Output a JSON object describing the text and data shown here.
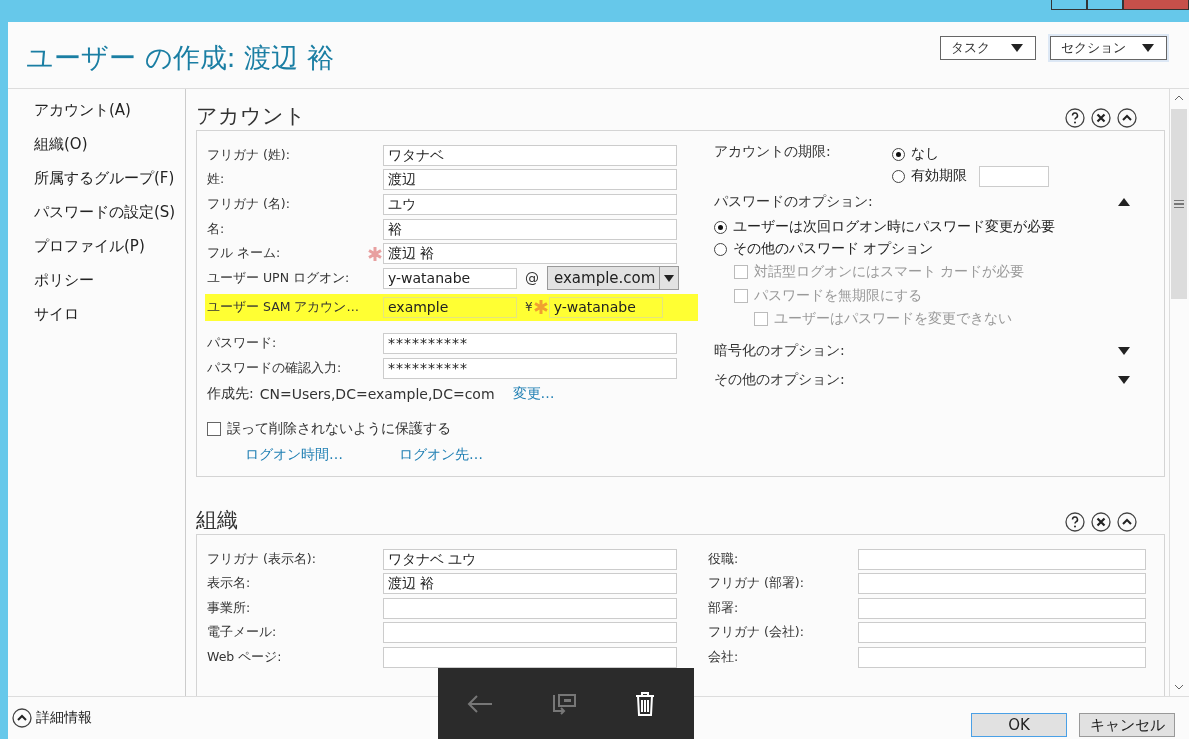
{
  "title": "ユーザー の作成: 渡辺 裕",
  "header_buttons": [
    {
      "label": "タスク"
    },
    {
      "label": "セクション"
    }
  ],
  "nav": [
    {
      "label": "アカウント(A)"
    },
    {
      "label": "組織(O)"
    },
    {
      "label": "所属するグループ(F)"
    },
    {
      "label": "パスワードの設定(S)"
    },
    {
      "label": "プロファイル(P)"
    },
    {
      "label": "ポリシー"
    },
    {
      "label": "サイロ"
    }
  ],
  "account": {
    "title": "アカウント",
    "fields": [
      {
        "label": "フリガナ (姓):",
        "kind": "text",
        "value": "ワタナベ",
        "required": false,
        "highlighted": false
      },
      {
        "label": "姓:",
        "kind": "text",
        "value": "渡辺",
        "required": false,
        "highlighted": false
      },
      {
        "label": "フリガナ (名):",
        "kind": "text",
        "value": "ユウ",
        "required": false,
        "highlighted": false
      },
      {
        "label": "名:",
        "kind": "text",
        "value": "裕",
        "required": false,
        "highlighted": false
      },
      {
        "label": "フル ネーム:",
        "kind": "text",
        "value": "渡辺 裕",
        "required": true,
        "highlighted": false
      },
      {
        "label": "ユーザー UPN ログオン:",
        "kind": "upn",
        "value": "y-watanabe",
        "separator": "@",
        "domain": "example.com",
        "required": false,
        "highlighted": false
      },
      {
        "label": "ユーザー SAM アカウン…",
        "kind": "sam",
        "prefix": "example",
        "separator": "¥",
        "value": "y-watanabe",
        "required": true,
        "highlighted": true
      }
    ],
    "password_fields": [
      {
        "label": "パスワード:",
        "value": "**********"
      },
      {
        "label": "パスワードの確認入力:",
        "value": "**********"
      }
    ],
    "created_in": {
      "label": "作成先:",
      "value": "CN=Users,DC=example,DC=com",
      "link": "変更…"
    },
    "protect": {
      "label": "誤って削除されないように保護する",
      "checked": false
    },
    "links": [
      "ログオン時間…",
      "ログオン先…"
    ],
    "expiry": {
      "label": "アカウントの期限:",
      "options": [
        {
          "label": "なし",
          "selected": true,
          "kind": "plain"
        },
        {
          "label": "有効期限",
          "selected": false,
          "kind": "date"
        }
      ]
    },
    "option_groups": [
      {
        "label": "パスワードのオプション:",
        "expanded": true,
        "radios": [
          {
            "label": "ユーザーは次回ログオン時にパスワード変更が必要",
            "selected": true
          },
          {
            "label": "その他のパスワード オプション",
            "selected": false
          }
        ],
        "checkboxes": [
          {
            "label": "対話型ログオンにはスマート カードが必要",
            "checked": false,
            "disabled": true
          },
          {
            "label": "パスワードを無期限にする",
            "checked": false,
            "disabled": true,
            "children": [
              {
                "label": "ユーザーはパスワードを変更できない",
                "checked": false,
                "disabled": true
              }
            ]
          }
        ]
      },
      {
        "label": "暗号化のオプション:",
        "expanded": false
      },
      {
        "label": "その他のオプション:",
        "expanded": false
      }
    ]
  },
  "organization": {
    "title": "組織",
    "left_fields": [
      {
        "label": "フリガナ (表示名):",
        "value": "ワタナベ ユウ"
      },
      {
        "label": "表示名:",
        "value": "渡辺 裕"
      },
      {
        "label": "事業所:"
      },
      {
        "label": "電子メール:"
      },
      {
        "label": "Web ページ:"
      }
    ],
    "right_fields": [
      {
        "label": "役職:"
      },
      {
        "label": "フリガナ (部署):"
      },
      {
        "label": "部署:"
      },
      {
        "label": "フリガナ (会社):"
      },
      {
        "label": "会社:"
      }
    ]
  },
  "footer": {
    "details": "詳細情報",
    "buttons": [
      "OK",
      "キャンセル"
    ]
  }
}
